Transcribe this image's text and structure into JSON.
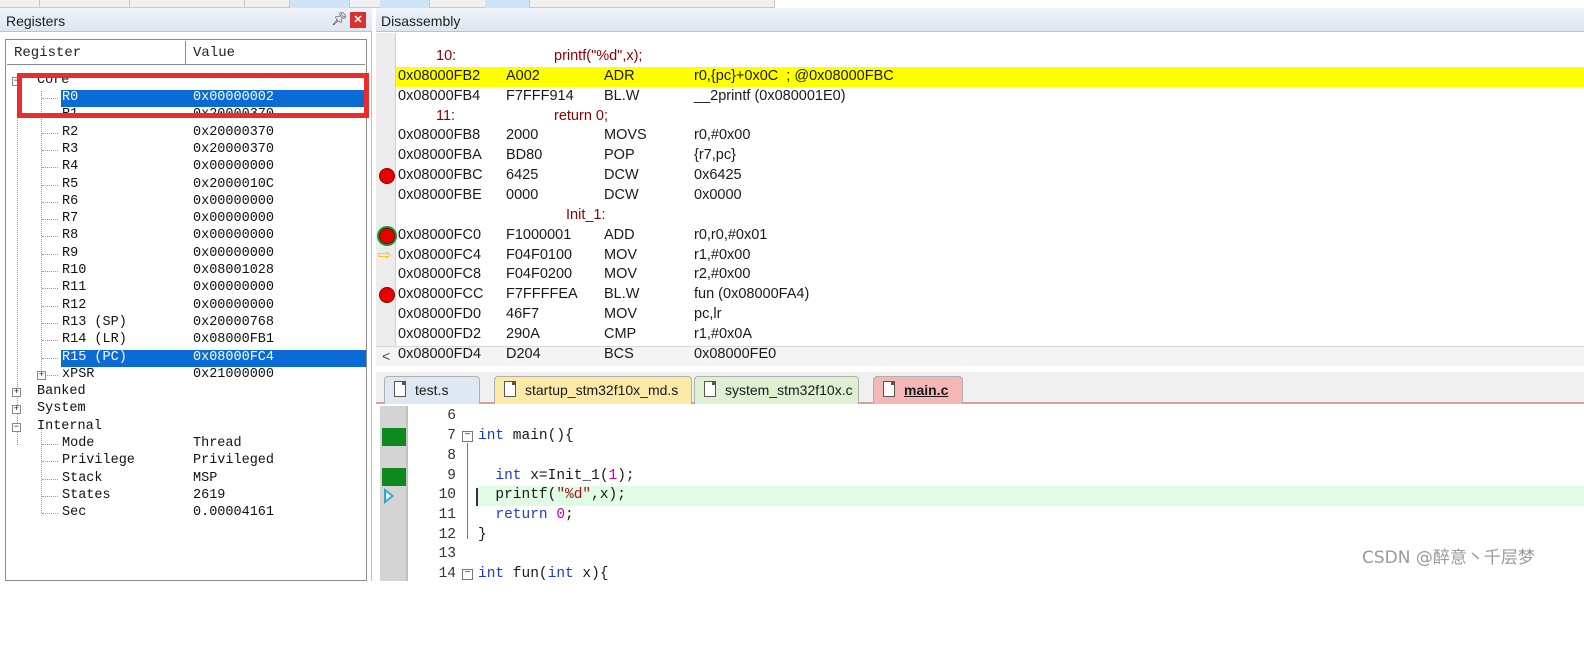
{
  "registers": {
    "title": "Registers",
    "pin_icon": "pin-icon",
    "close_icon": "close-icon",
    "columns": {
      "register": "Register",
      "value": "Value"
    },
    "core_label": "Core",
    "rows": [
      {
        "name": "R0",
        "value": "0x00000002"
      },
      {
        "name": "R1",
        "value": "0x20000370"
      },
      {
        "name": "R2",
        "value": "0x20000370"
      },
      {
        "name": "R3",
        "value": "0x20000370"
      },
      {
        "name": "R4",
        "value": "0x00000000"
      },
      {
        "name": "R5",
        "value": "0x2000010C"
      },
      {
        "name": "R6",
        "value": "0x00000000"
      },
      {
        "name": "R7",
        "value": "0x00000000"
      },
      {
        "name": "R8",
        "value": "0x00000000"
      },
      {
        "name": "R9",
        "value": "0x00000000"
      },
      {
        "name": "R10",
        "value": "0x08001028"
      },
      {
        "name": "R11",
        "value": "0x00000000"
      },
      {
        "name": "R12",
        "value": "0x00000000"
      },
      {
        "name": "R13 (SP)",
        "value": "0x20000768"
      },
      {
        "name": "R14 (LR)",
        "value": "0x08000FB1"
      },
      {
        "name": "R15 (PC)",
        "value": "0x08000FC4"
      },
      {
        "name": "xPSR",
        "value": "0x21000000"
      }
    ],
    "groups": [
      "Banked",
      "System",
      "Internal"
    ],
    "internal": [
      {
        "name": "Mode",
        "value": "Thread"
      },
      {
        "name": "Privilege",
        "value": "Privileged"
      },
      {
        "name": "Stack",
        "value": "MSP"
      },
      {
        "name": "States",
        "value": "2619"
      },
      {
        "name": "Sec",
        "value": "0.00004161"
      }
    ]
  },
  "disassembly": {
    "title": "Disassembly",
    "lines": [
      {
        "kind": "src",
        "lineno": "10:",
        "text": "printf(\"%d\",x);"
      },
      {
        "kind": "asm",
        "addr": "0x08000FB2",
        "op": "A002",
        "mn": "ADR",
        "args": "r0,{pc}+0x0C  ; @0x08000FBC",
        "current": true
      },
      {
        "kind": "asm",
        "addr": "0x08000FB4",
        "op": "F7FFF914",
        "mn": "BL.W",
        "args": "__2printf (0x080001E0)"
      },
      {
        "kind": "src",
        "lineno": "11:",
        "text": "return 0;"
      },
      {
        "kind": "asm",
        "addr": "0x08000FB8",
        "op": "2000",
        "mn": "MOVS",
        "args": "r0,#0x00"
      },
      {
        "kind": "asm",
        "addr": "0x08000FBA",
        "op": "BD80",
        "mn": "POP",
        "args": "{r7,pc}"
      },
      {
        "kind": "asm",
        "addr": "0x08000FBC",
        "op": "6425",
        "mn": "DCW",
        "args": "0x6425",
        "bp": "red"
      },
      {
        "kind": "asm",
        "addr": "0x08000FBE",
        "op": "0000",
        "mn": "DCW",
        "args": "0x0000"
      },
      {
        "kind": "label",
        "text": "Init_1:"
      },
      {
        "kind": "asm",
        "addr": "0x08000FC0",
        "op": "F1000001",
        "mn": "ADD",
        "args": "r0,r0,#0x01",
        "bp": "green"
      },
      {
        "kind": "asm",
        "addr": "0x08000FC4",
        "op": "F04F0100",
        "mn": "MOV",
        "args": "r1,#0x00",
        "arrow": true
      },
      {
        "kind": "asm",
        "addr": "0x08000FC8",
        "op": "F04F0200",
        "mn": "MOV",
        "args": "r2,#0x00"
      },
      {
        "kind": "asm",
        "addr": "0x08000FCC",
        "op": "F7FFFFEA",
        "mn": "BL.W",
        "args": "fun (0x08000FA4)",
        "bp": "red"
      },
      {
        "kind": "asm",
        "addr": "0x08000FD0",
        "op": "46F7",
        "mn": "MOV",
        "args": "pc,lr"
      },
      {
        "kind": "asm",
        "addr": "0x08000FD2",
        "op": "290A",
        "mn": "CMP",
        "args": "r1,#0x0A"
      },
      {
        "kind": "asm",
        "addr": "0x08000FD4",
        "op": "D204",
        "mn": "BCS",
        "args": "0x08000FE0"
      }
    ],
    "scroll_left": "<"
  },
  "tabs": [
    {
      "label": "test.s"
    },
    {
      "label": "startup_stm32f10x_md.s"
    },
    {
      "label": "system_stm32f10x.c"
    },
    {
      "label": "main.c"
    }
  ],
  "editor": {
    "lines": [
      "6",
      "7",
      "8",
      "9",
      "10",
      "11",
      "12",
      "13",
      "14"
    ]
  },
  "watermark": "CSDN @醉意丶千层梦"
}
